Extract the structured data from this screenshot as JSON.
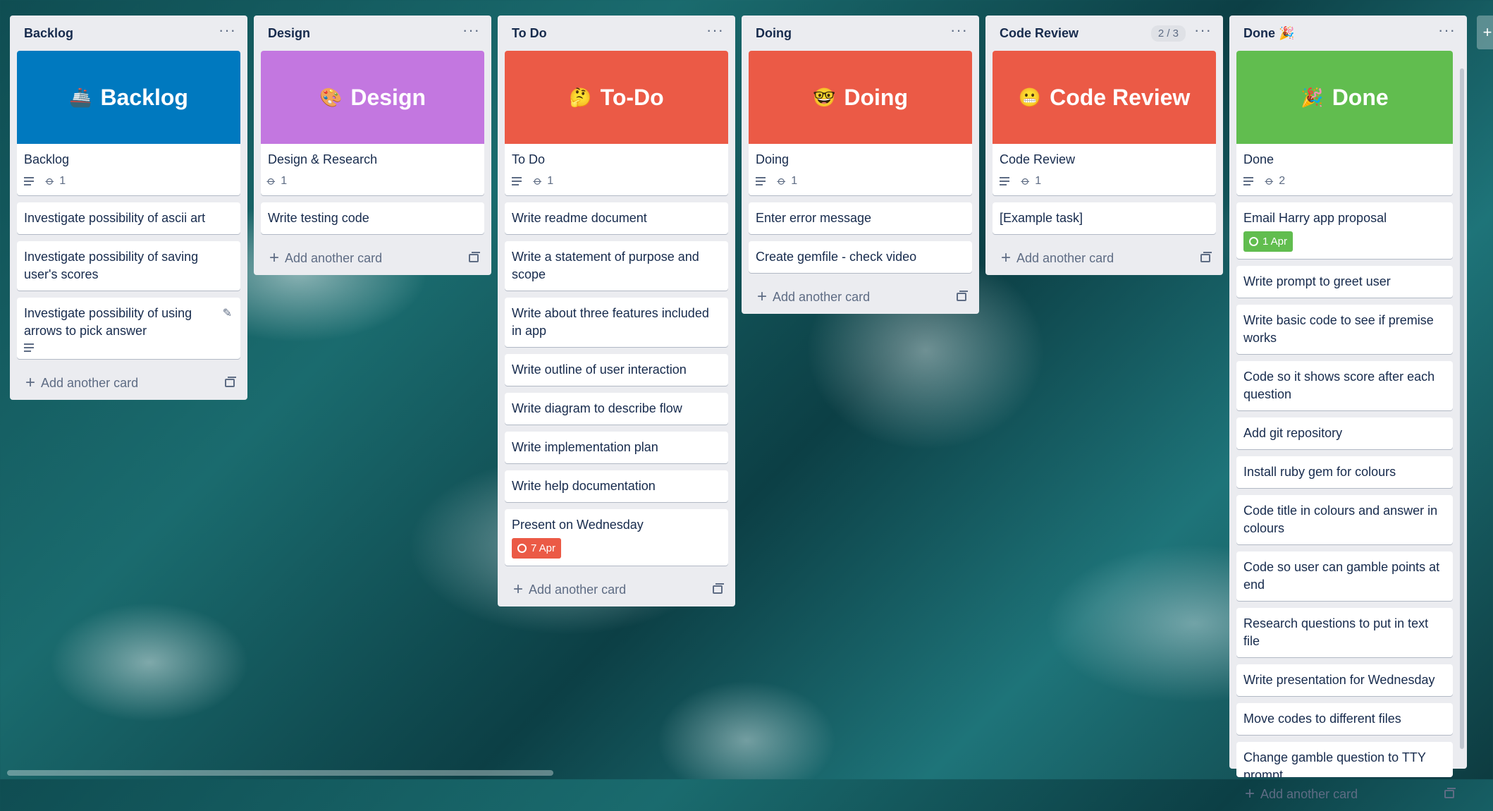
{
  "colors": {
    "backlog_cover": "#0079bf",
    "design_cover": "#c377e0",
    "todo_cover": "#eb5a46",
    "doing_cover": "#eb5a46",
    "review_cover": "#eb5a46",
    "done_cover": "#61bd4f",
    "due_complete": "#61bd4f",
    "due_overdue": "#eb5a46"
  },
  "lists": [
    {
      "title": "Backlog",
      "cover": {
        "emoji": "🚢",
        "text": "Backlog"
      },
      "cover_card": {
        "title": "Backlog",
        "attachments": "1",
        "has_description": true
      },
      "cards": [
        {
          "title": "Investigate possibility of ascii art"
        },
        {
          "title": "Investigate possibility of saving user's scores"
        },
        {
          "title": "Investigate possibility of using arrows to pick answer"
        }
      ],
      "add_label": "Add another card"
    },
    {
      "title": "Design",
      "cover": {
        "emoji": "🎨",
        "text": "Design"
      },
      "cover_card": {
        "title": "Design & Research",
        "attachments": "1",
        "has_description": false
      },
      "cards": [
        {
          "title": "Write testing code"
        }
      ],
      "add_label": "Add another card"
    },
    {
      "title": "To Do",
      "cover": {
        "emoji": "🤔",
        "text": "To-Do"
      },
      "cover_card": {
        "title": "To Do",
        "attachments": "1",
        "has_description": true
      },
      "cards": [
        {
          "title": "Write readme document"
        },
        {
          "title": "Write a statement of purpose and scope"
        },
        {
          "title": "Write about three features included in app"
        },
        {
          "title": "Write outline of user interaction"
        },
        {
          "title": "Write diagram to describe flow"
        },
        {
          "title": "Write implementation plan"
        },
        {
          "title": "Write help documentation"
        },
        {
          "title": "Present on Wednesday",
          "due": "7 Apr"
        }
      ],
      "add_label": "Add another card"
    },
    {
      "title": "Doing",
      "cover": {
        "emoji": "🤓",
        "text": "Doing"
      },
      "cover_card": {
        "title": "Doing",
        "attachments": "1",
        "has_description": true
      },
      "cards": [
        {
          "title": "Enter error message"
        },
        {
          "title": "Create gemfile - check video"
        }
      ],
      "add_label": "Add another card"
    },
    {
      "title": "Code Review",
      "count": "2 / 3",
      "cover": {
        "emoji": "😬",
        "text": "Code Review"
      },
      "cover_card": {
        "title": "Code Review",
        "attachments": "1",
        "has_description": true
      },
      "cards": [
        {
          "title": "[Example task]"
        }
      ],
      "add_label": "Add another card"
    },
    {
      "title": "Done 🎉",
      "cover": {
        "emoji": "🎉",
        "text": "Done"
      },
      "cover_card": {
        "title": "Done",
        "attachments": "2",
        "has_description": true
      },
      "cards": [
        {
          "title": "Email Harry app proposal",
          "due": "1 Apr"
        },
        {
          "title": "Write prompt to greet user"
        },
        {
          "title": "Write basic code to see if premise works"
        },
        {
          "title": "Code so it shows score after each question"
        },
        {
          "title": "Add git repository"
        },
        {
          "title": "Install ruby gem for colours"
        },
        {
          "title": "Code title in colours and answer in colours"
        },
        {
          "title": "Code so user can gamble points at end"
        },
        {
          "title": "Research questions to put in text file"
        },
        {
          "title": "Write presentation for Wednesday"
        },
        {
          "title": "Move codes to different files"
        },
        {
          "title": "Change gamble question to TTY prompt"
        }
      ],
      "add_label": "Add another card"
    }
  ],
  "menu_dots": "···",
  "plus_glyph": "+"
}
